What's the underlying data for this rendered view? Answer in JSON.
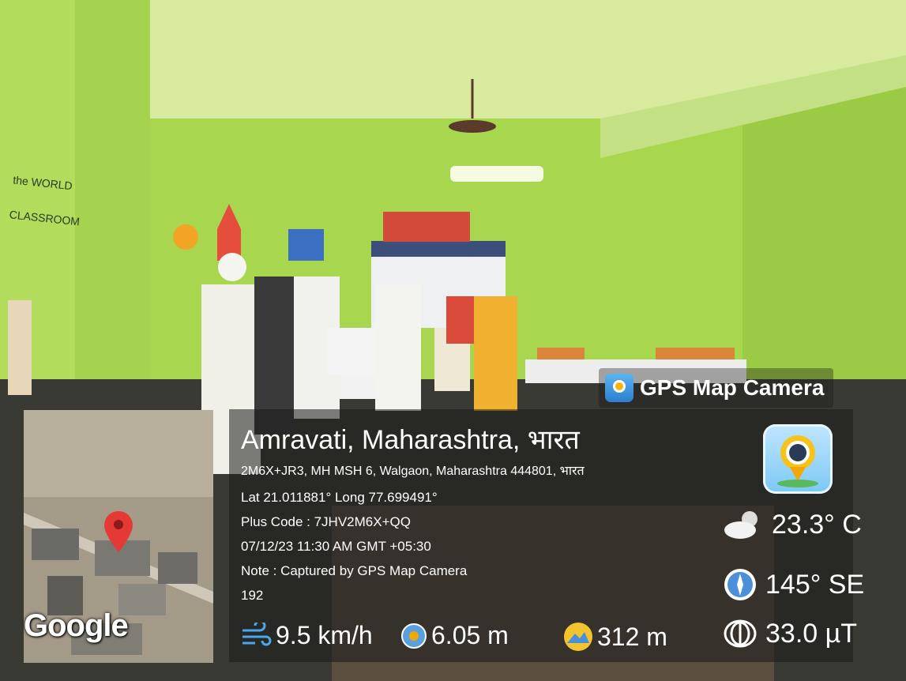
{
  "brand": {
    "label": "GPS Map Camera"
  },
  "map": {
    "provider_label": "Google"
  },
  "location": {
    "title": "Amravati, Maharashtra, भारत",
    "address": "2M6X+JR3, MH MSH 6, Walgaon, Maharashtra 444801, भारत",
    "coords": "Lat 21.011881° Long 77.699491°",
    "plus_code": "Plus Code : 7JHV2M6X+QQ",
    "datetime": "07/12/23 11:30 AM GMT +05:30",
    "note": "Note : Captured by GPS Map Camera",
    "number": "192"
  },
  "metrics": {
    "wind": "9.5 km/h",
    "accuracy": "6.05 m",
    "altitude": "312 m",
    "temperature": "23.3° C",
    "compass": "145° SE",
    "magnetic": "33.0 µT"
  },
  "wall_text": {
    "line1": "the WORLD",
    "line2": "CLASSROOM"
  },
  "icons": {
    "wind": "wind-icon",
    "accuracy": "target-icon",
    "altitude": "altitude-icon",
    "temperature": "cloud-sun-icon",
    "compass": "compass-icon",
    "magnetic": "magnet-icon",
    "map_pin": "map-pin-icon"
  },
  "colors": {
    "wall": "#a7d64a",
    "pin": "#e53935",
    "overlay": "#1b1b1b"
  }
}
